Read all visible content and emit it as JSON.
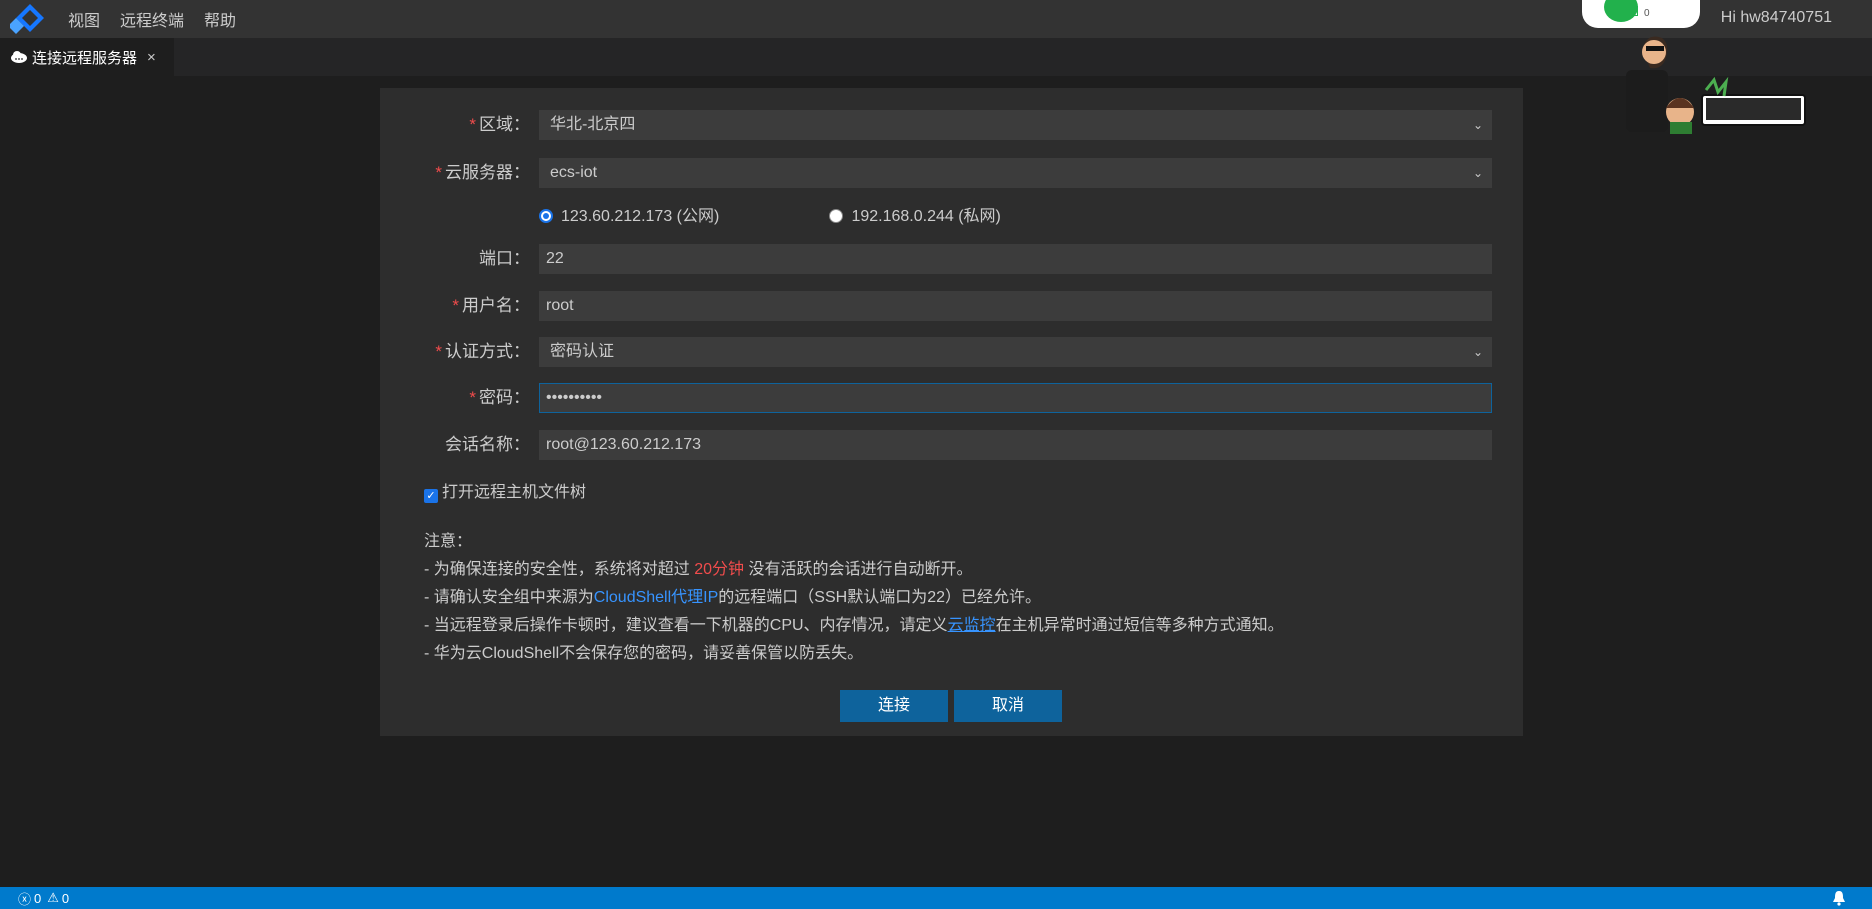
{
  "app": {
    "menu": [
      "视图",
      "远程终端",
      "帮助"
    ],
    "user_greeting": "Hi hw84740751",
    "wifi_count": "0"
  },
  "tab": {
    "title": "连接远程服务器",
    "close_glyph": "×"
  },
  "form": {
    "region": {
      "label": "区域：",
      "value": "华北-北京四",
      "required": true
    },
    "server": {
      "label": "云服务器：",
      "value": "ecs-iot",
      "required": true
    },
    "ip_options": [
      {
        "label": "123.60.212.173 (公网)",
        "selected": true
      },
      {
        "label": "192.168.0.244 (私网)",
        "selected": false
      }
    ],
    "port": {
      "label": "端口：",
      "value": "22",
      "required": false
    },
    "username": {
      "label": "用户名：",
      "value": "root",
      "required": true
    },
    "auth": {
      "label": "认证方式：",
      "value": "密码认证",
      "required": true
    },
    "password": {
      "label": "密码：",
      "value": "••••••••••",
      "required": true
    },
    "session": {
      "label": "会话名称：",
      "value": "root@123.60.212.173",
      "required": false
    },
    "open_file_tree": {
      "label": "打开远程主机文件树",
      "checked": true
    },
    "required_mark": "*"
  },
  "notes": {
    "title": "注意：",
    "line1_a": "- 为确保连接的安全性，系统将对超过 ",
    "line1_highlight": "20分钟",
    "line1_b": " 没有活跃的会话进行自动断开。",
    "line2_a": "- 请确认安全组中来源为",
    "line2_highlight": "CloudShell代理IP",
    "line2_b": "的远程端口（SSH默认端口为22）已经允许。",
    "line3_a": "- 当远程登录后操作卡顿时，建议查看一下机器的CPU、内存情况，请定义",
    "line3_link": "云监控",
    "line3_b": "在主机异常时通过短信等多种方式通知。",
    "line4": "- 华为云CloudShell不会保存您的密码，请妥善保管以防丢失。"
  },
  "buttons": {
    "connect": "连接",
    "cancel": "取消"
  },
  "status": {
    "errors": "0",
    "warnings": "0"
  },
  "colors": {
    "accent": "#0e639c",
    "statusbar": "#007acc",
    "required": "#f14c4c",
    "link": "#3794ff"
  }
}
